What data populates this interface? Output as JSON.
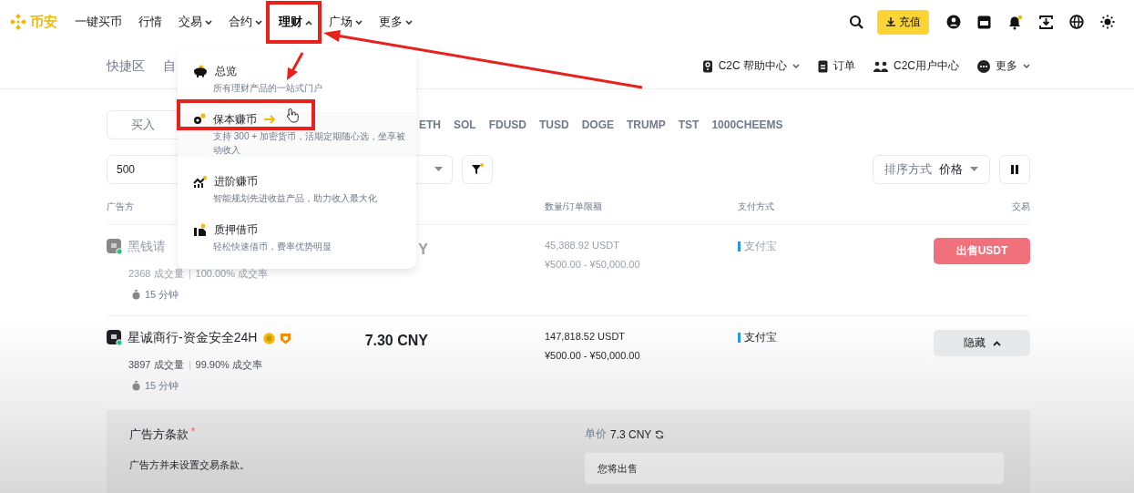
{
  "header": {
    "logo": "币安",
    "nav": [
      {
        "label": "一键买币",
        "dropdown": false,
        "expanded": false
      },
      {
        "label": "行情",
        "dropdown": false,
        "expanded": false
      },
      {
        "label": "交易",
        "dropdown": true,
        "expanded": false
      },
      {
        "label": "合约",
        "dropdown": true,
        "expanded": false
      },
      {
        "label": "理财",
        "dropdown": true,
        "expanded": true
      },
      {
        "label": "广场",
        "dropdown": true,
        "expanded": false
      },
      {
        "label": "更多",
        "dropdown": true,
        "expanded": false
      }
    ],
    "deposit_button": "充值",
    "notification_dot": true
  },
  "subnav": {
    "left": [
      "快捷区",
      "自"
    ],
    "right": [
      {
        "label": "C2C 帮助中心",
        "dropdown": true
      },
      {
        "label": "订单",
        "dropdown": false
      },
      {
        "label": "C2C用户中心",
        "dropdown": false
      },
      {
        "label": "更多",
        "dropdown": true
      }
    ]
  },
  "dropdown_menu": {
    "items": [
      {
        "title": "总览",
        "description": "所有理财产品的一站式门户",
        "selected": false
      },
      {
        "title": "保本赚币",
        "description": "支持 300 + 加密货币，活期定期随心选，坐享被动收入",
        "selected": true
      },
      {
        "title": "进阶赚币",
        "description": "智能规划先进收益产品，助力收入最大化",
        "selected": false
      },
      {
        "title": "质押借币",
        "description": "轻松快速借币，费率优势明显",
        "selected": false
      }
    ]
  },
  "trade_toggle": [
    {
      "label": "买入",
      "selected": false
    }
  ],
  "coins": [
    "ETH",
    "SOL",
    "FDUSD",
    "TUSD",
    "DOGE",
    "TRUMP",
    "TST",
    "1000CHEEMS"
  ],
  "filters": {
    "amount": "500",
    "sort_label": "排序方式",
    "sort_value": "价格"
  },
  "table": {
    "columns": [
      "广告方",
      "数量/订单限额",
      "支付方式",
      "交易"
    ],
    "rows": [
      {
        "dimmed": true,
        "name": "黑钱请",
        "merchant_badges": false,
        "orders": "2368 成交量",
        "completion": "100.00% 成交率",
        "time": "15 分钟",
        "price": "Y",
        "quantity": "45,388.92 USDT",
        "limits": "¥500.00 - ¥50,000.00",
        "payment": "支付宝",
        "action": {
          "kind": "sell",
          "label": "出售USDT"
        }
      },
      {
        "dimmed": false,
        "name": "星诚商行-资金安全24H",
        "merchant_badges": true,
        "orders": "3897 成交量",
        "completion": "99.90% 成交率",
        "time": "15 分钟",
        "price": "7.30 CNY",
        "quantity": "147,818.52 USDT",
        "limits": "¥500.00 - ¥50,000.00",
        "payment": "支付宝",
        "action": {
          "kind": "hide",
          "label": "隐藏"
        }
      }
    ]
  },
  "terms_panel": {
    "title": "广告方条款",
    "required_mark": "*",
    "text": "广告方并未设置交易条款。",
    "unit_price_label": "单价",
    "unit_price": "7.3 CNY",
    "sell_field_label": "您将出售"
  }
}
